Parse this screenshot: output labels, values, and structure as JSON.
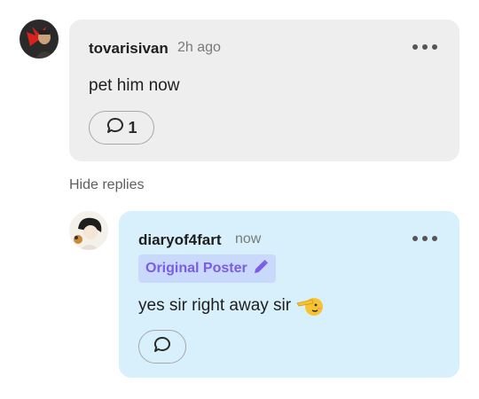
{
  "comment": {
    "username": "tovarisivan",
    "time": "2h ago",
    "text": "pet him now",
    "reply_count": "1"
  },
  "hide_replies_label": "Hide replies",
  "reply": {
    "username": "diaryof4fart",
    "time": "now",
    "badge": "Original Poster",
    "text": "yes sir right away sir",
    "emoji": "🫡"
  },
  "colors": {
    "main_card_bg": "#eeeeee",
    "reply_card_bg": "#d8f0fb",
    "badge_bg": "#c9d9fb",
    "badge_text": "#7b5ce6"
  }
}
